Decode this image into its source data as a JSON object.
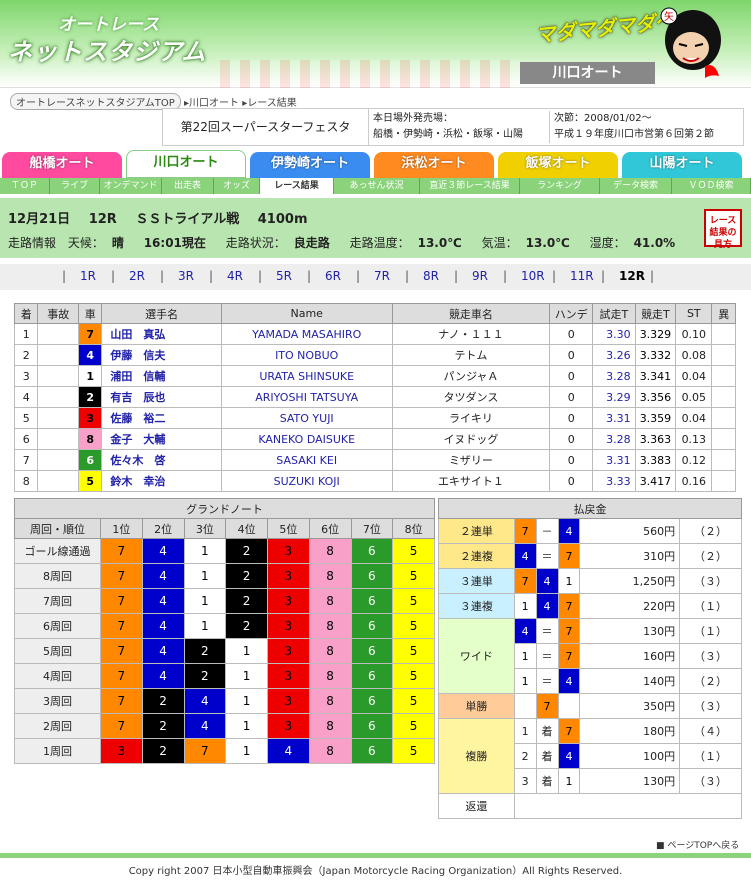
{
  "header": {
    "logo_line1": "オートレース",
    "logo_line2": "ネットスタジアム",
    "mascot_text": "マダマダマダ～",
    "venue_banner": "川口オート"
  },
  "breadcrumb": {
    "top": "オートレースネットスタジアムTOP",
    "venue": "川口オート",
    "page": "レース結果"
  },
  "event": {
    "title": "第22回スーパースターフェスタ",
    "other_label": "本日場外発売場：",
    "other_venues": "船橋・伊勢崎・浜松・飯塚・山陽",
    "next_label": "次節：2008/01/02～",
    "next_detail": "平成１９年度川口市営第６回第２節"
  },
  "venues": [
    {
      "label": "船橋オート",
      "color": "#ff4aa0"
    },
    {
      "label": "川口オート",
      "color": "#ffffff"
    },
    {
      "label": "伊勢崎オート",
      "color": "#3a8cf0"
    },
    {
      "label": "浜松オート",
      "color": "#ff8a20"
    },
    {
      "label": "飯塚オート",
      "color": "#f0d000"
    },
    {
      "label": "山陽オート",
      "color": "#30c8d8"
    }
  ],
  "subnav": [
    "ＴＯＰ",
    "ライブ",
    "オンデマンド",
    "出走表",
    "オッズ",
    "レース結果",
    "あっせん状況",
    "直近３節レース結果",
    "ランキング",
    "データ検索",
    "ＶＯＤ検索"
  ],
  "race": {
    "date": "12月21日",
    "number": "12R",
    "name": "ＳＳトライアル戦",
    "distance": "4100m",
    "info_label": "走路情報",
    "weather_label": "天候：",
    "weather": "晴",
    "time": "16:01現在",
    "track_label": "走路状況：",
    "track": "良走路",
    "temp_label": "走路温度：",
    "temp": "13.0℃",
    "air_label": "気温：",
    "air": "13.0℃",
    "hum_label": "湿度：",
    "hum": "41.0%",
    "result_btn": "レース結果の見方"
  },
  "race_nav": [
    "1R",
    "2R",
    "3R",
    "4R",
    "5R",
    "6R",
    "7R",
    "8R",
    "9R",
    "10R",
    "11R",
    "12R"
  ],
  "results": {
    "headers": [
      "着",
      "事故",
      "車",
      "選手名",
      "Name",
      "競走車名",
      "ハンデ",
      "試走T",
      "競走T",
      "ST",
      "異"
    ],
    "rows": [
      {
        "pos": "1",
        "acc": "",
        "car": "7",
        "name": "山田　真弘",
        "en": "YAMADA MASAHIRO",
        "bike": "ナノ・１１１",
        "h": "0",
        "t1": "3.30",
        "t2": "3.329",
        "st": "0.10",
        "x": ""
      },
      {
        "pos": "2",
        "acc": "",
        "car": "4",
        "name": "伊藤　信夫",
        "en": "ITO NOBUO",
        "bike": "テトム",
        "h": "0",
        "t1": "3.26",
        "t2": "3.332",
        "st": "0.08",
        "x": ""
      },
      {
        "pos": "3",
        "acc": "",
        "car": "1",
        "name": "浦田　信輔",
        "en": "URATA SHINSUKE",
        "bike": "パンジャＡ",
        "h": "0",
        "t1": "3.28",
        "t2": "3.341",
        "st": "0.04",
        "x": ""
      },
      {
        "pos": "4",
        "acc": "",
        "car": "2",
        "name": "有吉　辰也",
        "en": "ARIYOSHI TATSUYA",
        "bike": "タツダンス",
        "h": "0",
        "t1": "3.29",
        "t2": "3.356",
        "st": "0.05",
        "x": ""
      },
      {
        "pos": "5",
        "acc": "",
        "car": "3",
        "name": "佐藤　裕二",
        "en": "SATO YUJI",
        "bike": "ライキリ",
        "h": "0",
        "t1": "3.31",
        "t2": "3.359",
        "st": "0.04",
        "x": ""
      },
      {
        "pos": "6",
        "acc": "",
        "car": "8",
        "name": "金子　大輔",
        "en": "KANEKO DAISUKE",
        "bike": "イヌドッグ",
        "h": "0",
        "t1": "3.28",
        "t2": "3.363",
        "st": "0.13",
        "x": ""
      },
      {
        "pos": "7",
        "acc": "",
        "car": "6",
        "name": "佐々木　啓",
        "en": "SASAKI KEI",
        "bike": "ミザリー",
        "h": "0",
        "t1": "3.31",
        "t2": "3.383",
        "st": "0.12",
        "x": ""
      },
      {
        "pos": "8",
        "acc": "",
        "car": "5",
        "name": "鈴木　幸治",
        "en": "SUZUKI KOJI",
        "bike": "エキサイト１",
        "h": "0",
        "t1": "3.33",
        "t2": "3.417",
        "st": "0.16",
        "x": ""
      }
    ]
  },
  "grand_note": {
    "title": "グランドノート",
    "headers": [
      "周回・順位",
      "1位",
      "2位",
      "3位",
      "4位",
      "5位",
      "6位",
      "7位",
      "8位"
    ],
    "rows": [
      {
        "label": "ゴール線通過",
        "cars": [
          "7",
          "4",
          "1",
          "2",
          "3",
          "8",
          "6",
          "5"
        ]
      },
      {
        "label": "8周回",
        "cars": [
          "7",
          "4",
          "1",
          "2",
          "3",
          "8",
          "6",
          "5"
        ]
      },
      {
        "label": "7周回",
        "cars": [
          "7",
          "4",
          "1",
          "2",
          "3",
          "8",
          "6",
          "5"
        ]
      },
      {
        "label": "6周回",
        "cars": [
          "7",
          "4",
          "1",
          "2",
          "3",
          "8",
          "6",
          "5"
        ]
      },
      {
        "label": "5周回",
        "cars": [
          "7",
          "4",
          "2",
          "1",
          "3",
          "8",
          "6",
          "5"
        ]
      },
      {
        "label": "4周回",
        "cars": [
          "7",
          "4",
          "2",
          "1",
          "3",
          "8",
          "6",
          "5"
        ]
      },
      {
        "label": "3周回",
        "cars": [
          "7",
          "2",
          "4",
          "1",
          "3",
          "8",
          "6",
          "5"
        ]
      },
      {
        "label": "2周回",
        "cars": [
          "7",
          "2",
          "4",
          "1",
          "3",
          "8",
          "6",
          "5"
        ]
      },
      {
        "label": "1周回",
        "cars": [
          "3",
          "2",
          "7",
          "1",
          "4",
          "8",
          "6",
          "5"
        ]
      }
    ]
  },
  "payout": {
    "title": "払戻金",
    "nirentan": {
      "label": "２連単",
      "a": "7",
      "sep": "－",
      "b": "4",
      "amt": "560円",
      "pop": "（２）"
    },
    "nirenpuku": {
      "label": "２連複",
      "a": "4",
      "sep": "＝",
      "b": "7",
      "amt": "310円",
      "pop": "（２）"
    },
    "sanrentan": {
      "label": "３連単",
      "a": "7",
      "b": "4",
      "c": "1",
      "amt": "1,250円",
      "pop": "（３）"
    },
    "sanrenpuku": {
      "label": "３連複",
      "a": "1",
      "b": "4",
      "c": "7",
      "amt": "220円",
      "pop": "（１）"
    },
    "wide_label": "ワイド",
    "wide": [
      {
        "a": "4",
        "sep": "＝",
        "b": "7",
        "amt": "130円",
        "pop": "（１）"
      },
      {
        "a": "1",
        "sep": "＝",
        "b": "7",
        "amt": "160円",
        "pop": "（３）"
      },
      {
        "a": "1",
        "sep": "＝",
        "b": "4",
        "amt": "140円",
        "pop": "（２）"
      }
    ],
    "tansho": {
      "label": "単勝",
      "car": "7",
      "amt": "350円",
      "pop": "（３）"
    },
    "fukusho_label": "複勝",
    "fukusho": [
      {
        "rank": "1",
        "chaku": "着",
        "car": "7",
        "amt": "180円",
        "pop": "（４）"
      },
      {
        "rank": "2",
        "chaku": "着",
        "car": "4",
        "amt": "100円",
        "pop": "（１）"
      },
      {
        "rank": "3",
        "chaku": "着",
        "car": "1",
        "amt": "130円",
        "pop": "（３）"
      }
    ],
    "refund_label": "返還"
  },
  "page_top": "ページTOPへ戻る",
  "copyright": "Copy right 2007 日本小型自動車振興会（Japan Motorcycle Racing Organization）All Rights Reserved."
}
